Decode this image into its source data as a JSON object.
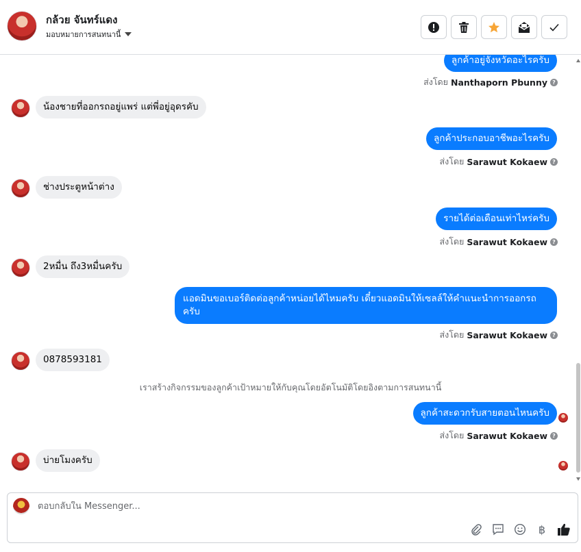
{
  "header": {
    "contact_name": "กล้วย จันทร์แดง",
    "assign_label": "มอบหมายการสนทนานี้"
  },
  "conversation": {
    "messages": [
      {
        "direction": "out",
        "text": "ลูกค้าอยู่จังหวัดอะไรครับ",
        "sent_by_label": "ส่งโดย",
        "sender": "Nanthaporn Pbunny"
      },
      {
        "direction": "in",
        "text": "น้องชายที่ออกรถอยู่แพร่ แต่พี่อยู่อุดรคับ"
      },
      {
        "direction": "out",
        "text": "ลูกค้าประกอบอาชีพอะไรครับ",
        "sent_by_label": "ส่งโดย",
        "sender": "Sarawut Kokaew"
      },
      {
        "direction": "in",
        "text": "ช่างประตูหน้าต่าง"
      },
      {
        "direction": "out",
        "text": "รายได้ต่อเดือนเท่าไหร่ครับ",
        "sent_by_label": "ส่งโดย",
        "sender": "Sarawut Kokaew"
      },
      {
        "direction": "in",
        "text": "2หมื่น ถึง3หมื่นครับ"
      },
      {
        "direction": "out",
        "text": "แอดมินขอเบอร์ติดต่อลูกค้าหน่อยได้ไหมครับ เดี๋ยวแอดมินให้เซลล์ให้คำแนะนำการออกรถครับ",
        "sent_by_label": "ส่งโดย",
        "sender": "Sarawut Kokaew"
      },
      {
        "direction": "in",
        "text": "0878593181"
      },
      {
        "direction": "system",
        "text": "เราสร้างกิจกรรมของลูกค้าเป้าหมายให้กับคุณโดยอัตโนมัติโดยอิงตามการสนทนานี้"
      },
      {
        "direction": "out",
        "text": "ลูกค้าสะดวกรับสายตอนไหนครับ",
        "sent_by_label": "ส่งโดย",
        "sender": "Sarawut Kokaew"
      },
      {
        "direction": "in",
        "text": "บ่ายโมงครับ"
      }
    ]
  },
  "composer": {
    "placeholder": "ตอบกลับใน Messenger..."
  },
  "colors": {
    "outgoing_bubble": "#0a7cff",
    "incoming_bubble": "#eeeff1",
    "star": "#f7a536"
  },
  "icons": [
    "report-icon",
    "trash-icon",
    "star-icon",
    "mark-unread-icon",
    "check-icon",
    "attachment-icon",
    "saved-reply-icon",
    "emoji-icon",
    "baht-icon",
    "thumbs-up-icon",
    "info-icon"
  ]
}
